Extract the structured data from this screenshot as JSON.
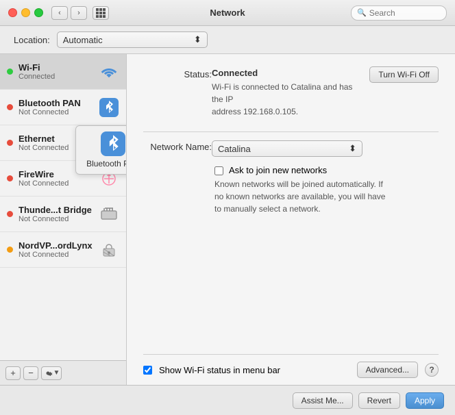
{
  "titlebar": {
    "title": "Network",
    "search_placeholder": "Search"
  },
  "location": {
    "label": "Location:",
    "value": "Automatic"
  },
  "sidebar": {
    "items": [
      {
        "id": "wifi",
        "name": "Wi-Fi",
        "status": "Connected",
        "dot": "green",
        "icon": "wifi"
      },
      {
        "id": "bluetooth",
        "name": "Bluetooth PAN",
        "status": "Not Connected",
        "dot": "red",
        "icon": "bluetooth"
      },
      {
        "id": "ethernet",
        "name": "Ethernet",
        "status": "Not Connected",
        "dot": "red",
        "icon": "ethernet"
      },
      {
        "id": "firewire",
        "name": "FireWire",
        "status": "Not Connected",
        "dot": "red",
        "icon": "firewire"
      },
      {
        "id": "thunderbolt",
        "name": "Thunde...t Bridge",
        "status": "Not Connected",
        "dot": "red",
        "icon": "thunderbolt"
      },
      {
        "id": "nordvpn",
        "name": "NordVP...ordLynx",
        "status": "Not Connected",
        "dot": "orange",
        "icon": "vpn"
      }
    ],
    "tooltip": {
      "label": "Bluetooth PAN"
    },
    "bottom_buttons": {
      "add": "+",
      "remove": "−",
      "gear": "⚙"
    }
  },
  "panel": {
    "status_label": "Status:",
    "status_value": "Connected",
    "status_description": "Wi-Fi is connected to Catalina and has the IP\naddress 192.168.0.105.",
    "turn_off_btn": "Turn Wi-Fi Off",
    "network_name_label": "Network Name:",
    "network_name_value": "Catalina",
    "ask_to_join_label": "Ask to join new networks",
    "ask_to_join_desc": "Known networks will be joined automatically. If\nno known networks are available, you will have\nto manually select a network.",
    "show_wifi_label": "Show Wi-Fi status in menu bar",
    "advanced_btn": "Advanced...",
    "help_btn": "?"
  },
  "footer": {
    "assist_btn": "Assist Me...",
    "revert_btn": "Revert",
    "apply_btn": "Apply"
  }
}
